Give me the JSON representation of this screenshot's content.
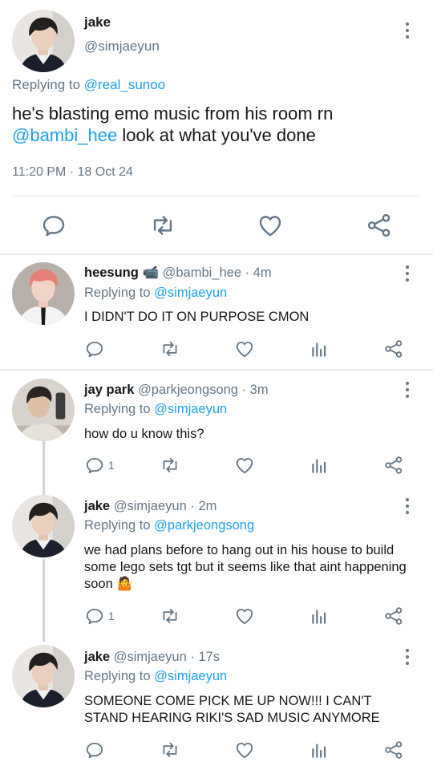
{
  "main_tweet": {
    "name": "jake",
    "handle": "@simjaeyun",
    "replying_prefix": "Replying to",
    "replying_to": "@real_sunoo",
    "text_part1": "he's blasting emo music from his room rn",
    "mention": "@bambi_hee",
    "text_part2": "look at what you've done",
    "timestamp": "11:20 PM · 18 Oct 24"
  },
  "replies": [
    {
      "name": "heesung",
      "emoji": "📹",
      "handle": "@bambi_hee",
      "time": "· 4m",
      "replying_prefix": "Replying to",
      "replying_to": "@simjaeyun",
      "text": "I DIDN'T DO IT ON PURPOSE CMON",
      "reply_count": ""
    },
    {
      "name": "jay park",
      "handle": "@parkjeongsong",
      "time": "· 3m",
      "replying_prefix": "Replying to",
      "replying_to": "@simjaeyun",
      "text": "how do u know this?",
      "reply_count": "1"
    },
    {
      "name": "jake",
      "handle": "@simjaeyun",
      "time": "· 2m",
      "replying_prefix": "Replying to",
      "replying_to": "@parkjeongsong",
      "text": "we had plans before to hang out in his house to build some lego sets tgt but it seems like that aint happening soon",
      "emoji": "🤷",
      "reply_count": "1"
    },
    {
      "name": "jake",
      "handle": "@simjaeyun",
      "time": "· 17s",
      "replying_prefix": "Replying to",
      "replying_to": "@simjaeyun",
      "text": "SOMEONE COME PICK ME UP NOW!!! I CAN'T STAND HEARING RIKI'S SAD MUSIC ANYMORE",
      "reply_count": ""
    }
  ],
  "colors": {
    "link": "#1da1f2",
    "icon": "#657786",
    "divider": "#e1e8ed",
    "thread_line": "#ccd6dd"
  },
  "icons": [
    "reply-icon",
    "retweet-icon",
    "like-icon",
    "analytics-icon",
    "share-icon",
    "more-icon"
  ]
}
